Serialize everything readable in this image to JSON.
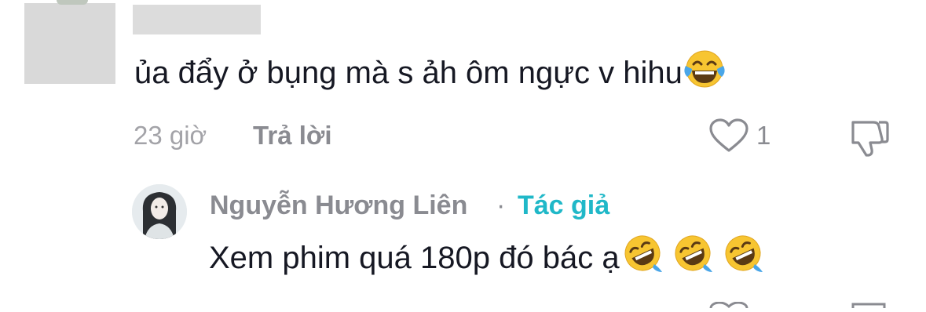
{
  "comment": {
    "text": "ủa đẩy ở bụng mà s ảh ôm ngực v hihu",
    "emoji_icon": "face-with-tears-of-joy-icon",
    "time": "23 giờ",
    "reply_label": "Trả lời",
    "like_count": "1"
  },
  "reply": {
    "author": "Nguyễn Hương Liên",
    "separator": "·",
    "badge": "Tác giả",
    "text": "Xem phim quá 180p đó bác ạ",
    "emoji_icons": [
      "rolling-on-floor-laughing-icon",
      "rolling-on-floor-laughing-icon",
      "rolling-on-floor-laughing-icon"
    ]
  },
  "colors": {
    "text_primary": "#161823",
    "text_secondary": "#8a8b91",
    "author_badge": "#20b8c8",
    "emoji_yellow": "#f7c531"
  }
}
